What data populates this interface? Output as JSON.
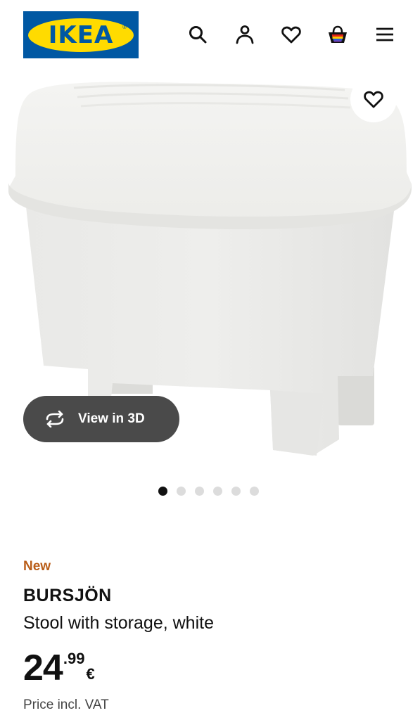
{
  "brand": {
    "logo_text": "IKEA",
    "colors": {
      "blue": "#0058a3",
      "yellow": "#ffdb00"
    }
  },
  "header": {
    "icons": [
      "search-icon",
      "account-icon",
      "favourites-icon",
      "shopping-bag-icon",
      "menu-icon"
    ]
  },
  "gallery": {
    "view_3d_label": "View in 3D",
    "dot_count": 6,
    "active_index": 0
  },
  "product": {
    "badge": "New",
    "name": "BURSJÖN",
    "description": "Stool with storage, white",
    "price_integer": "24",
    "price_decimal": ".99",
    "currency": "€",
    "price_note": "Price incl. VAT",
    "badge_color": "#b95d18"
  }
}
